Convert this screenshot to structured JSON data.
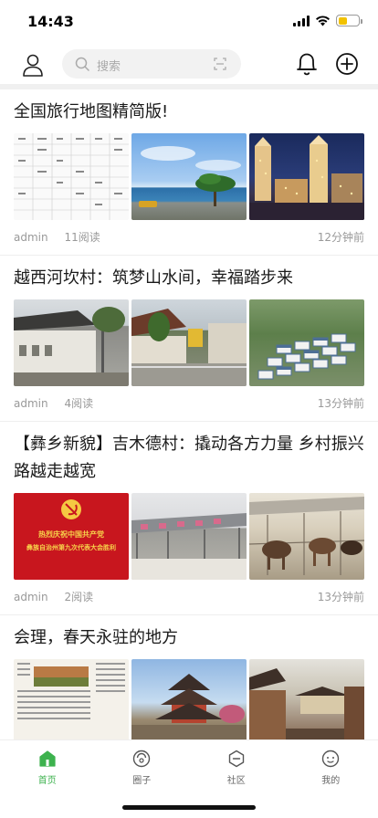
{
  "status_bar": {
    "time": "14:43",
    "battery_level": 0.45
  },
  "header": {
    "search_placeholder": "搜索"
  },
  "articles": [
    {
      "title": "全国旅行地图精简版!",
      "author": "admin",
      "reads": "11阅读",
      "time": "12分钟前"
    },
    {
      "title": "越西河坎村：筑梦山水间，幸福踏步来",
      "author": "admin",
      "reads": "4阅读",
      "time": "13分钟前"
    },
    {
      "title": "【彝乡新貌】吉木德村：撬动各方力量 乡村振兴路越走越宽",
      "author": "admin",
      "reads": "2阅读",
      "time": "13分钟前",
      "banner_line1": "热烈庆祝中国共产党",
      "banner_line2": "彝族自治州第九次代表大会胜利"
    },
    {
      "title": "会理，春天永驻的地方",
      "author": "",
      "reads": "",
      "time": ""
    }
  ],
  "nav": [
    {
      "label": "首页",
      "icon": "home-icon",
      "active": true
    },
    {
      "label": "圈子",
      "icon": "circle-smile-icon",
      "active": false
    },
    {
      "label": "社区",
      "icon": "community-icon",
      "active": false
    },
    {
      "label": "我的",
      "icon": "profile-face-icon",
      "active": false
    }
  ],
  "colors": {
    "accent": "#3db24e",
    "battery": "#f2c200",
    "banner_red": "#c8161e"
  }
}
